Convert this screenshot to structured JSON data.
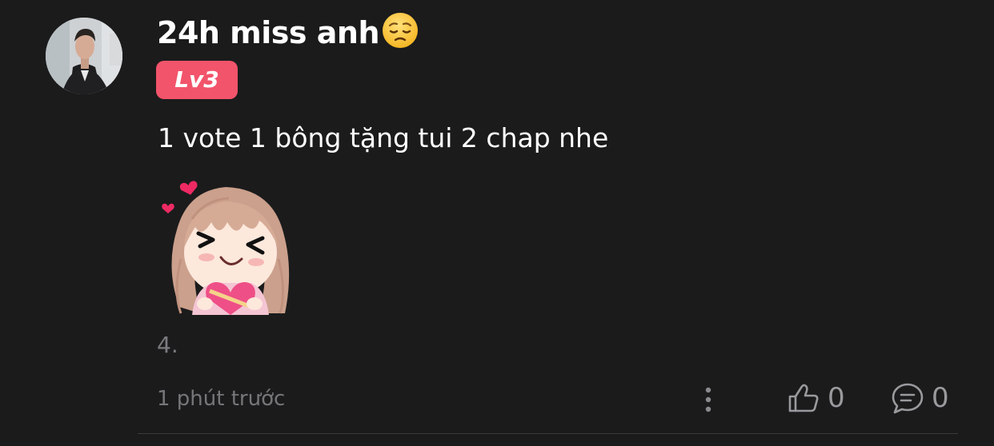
{
  "comment": {
    "author": "24h miss anh",
    "author_emoji_icon": "pensive-face-emoji",
    "level_badge": "Lv3",
    "text": "1 vote 1 bông tặng tui 2 chap nhe",
    "sticker_icon": "girl-holding-heart-sticker",
    "extra_text": "4.",
    "timestamp": "1 phút trước",
    "likes": "0",
    "replies": "0"
  },
  "colors": {
    "background": "#1b1b1c",
    "badge": "#f2546b",
    "muted_text": "#76767a"
  }
}
